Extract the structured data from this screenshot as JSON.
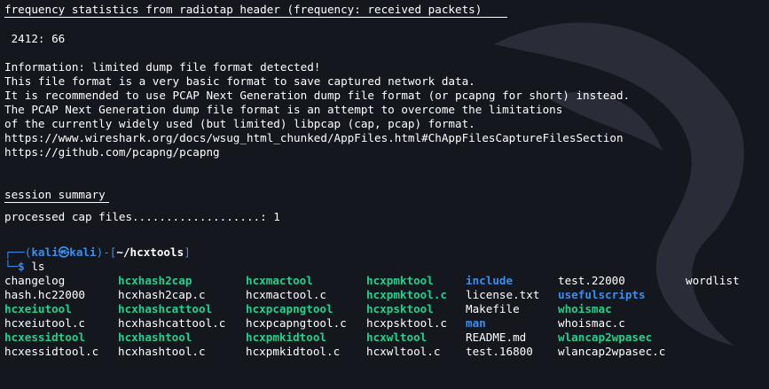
{
  "header": {
    "freq_title": "frequency statistics from radiotap header (frequency: received packets)",
    "freq_value": " 2412: 66"
  },
  "info": [
    "Information: limited dump file format detected!",
    "This file format is a very basic format to save captured network data.",
    "It is recommended to use PCAP Next Generation dump file format (or pcapng for short) instead.",
    "The PCAP Next Generation dump file format is an attempt to overcome the limitations",
    "of the currently widely used (but limited) libpcap (cap, pcap) format.",
    "https://www.wireshark.org/docs/wsug_html_chunked/AppFiles.html#ChAppFilesCaptureFilesSection",
    "https://github.com/pcapng/pcapng"
  ],
  "summary": {
    "title": "session summary",
    "processed": "processed cap files...................: 1"
  },
  "prompt": {
    "open": "┌──(",
    "user": "kali㉿kali",
    "mid": ")-[",
    "path": "~/hcxtools",
    "close": "]",
    "second": "└─",
    "dollar": "$",
    "command": " ls"
  },
  "ls_rows": [
    [
      [
        "changelog",
        "file"
      ],
      [
        "hcxhash2cap",
        "exec"
      ],
      [
        "hcxmactool",
        "exec"
      ],
      [
        "hcxpmktool",
        "exec"
      ],
      [
        "include",
        "dir"
      ],
      [
        "test.22000",
        "file"
      ],
      [
        "wordlist",
        "file"
      ]
    ],
    [
      [
        "hash.hc22000",
        "file"
      ],
      [
        "hcxhash2cap.c",
        "file"
      ],
      [
        "hcxmactool.c",
        "file"
      ],
      [
        "hcxpmktool.c",
        "exec"
      ],
      [
        "license.txt",
        "file"
      ],
      [
        "usefulscripts",
        "dir"
      ],
      [
        "",
        ""
      ]
    ],
    [
      [
        "hcxeiutool",
        "exec"
      ],
      [
        "hcxhashcattool",
        "exec"
      ],
      [
        "hcxpcapngtool",
        "exec"
      ],
      [
        "hcxpsktool",
        "exec"
      ],
      [
        "Makefile",
        "file"
      ],
      [
        "whoismac",
        "exec"
      ],
      [
        "",
        ""
      ]
    ],
    [
      [
        "hcxeiutool.c",
        "file"
      ],
      [
        "hcxhashcattool.c",
        "file"
      ],
      [
        "hcxpcapngtool.c",
        "file"
      ],
      [
        "hcxpsktool.c",
        "file"
      ],
      [
        "man",
        "dir"
      ],
      [
        "whoismac.c",
        "file"
      ],
      [
        "",
        ""
      ]
    ],
    [
      [
        "hcxessidtool",
        "exec"
      ],
      [
        "hcxhashtool",
        "exec"
      ],
      [
        "hcxpmkidtool",
        "exec"
      ],
      [
        "hcxwltool",
        "exec"
      ],
      [
        "README.md",
        "file"
      ],
      [
        "wlancap2wpasec",
        "exec"
      ],
      [
        "",
        ""
      ]
    ],
    [
      [
        "hcxessidtool.c",
        "file"
      ],
      [
        "hcxhashtool.c",
        "file"
      ],
      [
        "hcxpmkidtool.c",
        "file"
      ],
      [
        "hcxwltool.c",
        "file"
      ],
      [
        "test.16800",
        "file"
      ],
      [
        "wlancap2wpasec.c",
        "file"
      ],
      [
        "",
        ""
      ]
    ]
  ],
  "colors": {
    "background": "#15171f",
    "executable": "#23d18b",
    "directory": "#3b8eea",
    "text": "#ffffff"
  }
}
